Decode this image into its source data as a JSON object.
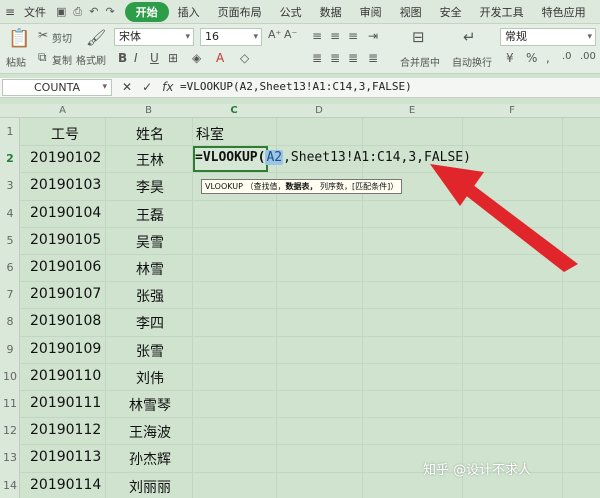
{
  "menubar": {
    "file_label": "文件",
    "tabs": [
      "开始",
      "插入",
      "页面布局",
      "公式",
      "数据",
      "审阅",
      "视图",
      "安全",
      "开发工具",
      "特色应用"
    ],
    "active_tab": "开始"
  },
  "ribbon": {
    "paste_label": "粘贴",
    "cut_label": "剪切",
    "copy_label": "复制",
    "format_painter_label": "格式刷",
    "font_name": "宋体",
    "font_size": "16",
    "merge_label": "合并居中",
    "wrap_label": "自动换行",
    "number_format": "常规"
  },
  "formula_bar": {
    "name_box": "COUNTA",
    "cancel_icon": "✕",
    "confirm_icon": "✓",
    "fx_label": "fx",
    "formula": "=VLOOKUP(A2,Sheet13!A1:C14,3,FALSE)"
  },
  "grid": {
    "columns": [
      "A",
      "B",
      "C",
      "D",
      "E",
      "F"
    ],
    "selected_column": "C",
    "rows": [
      "1",
      "2",
      "3",
      "4",
      "5",
      "6",
      "7",
      "8",
      "9",
      "10",
      "11",
      "12",
      "13",
      "14"
    ],
    "selected_row": "2",
    "header_a": "工号",
    "header_b": "姓名",
    "header_c": "科室",
    "ids": [
      "20190102",
      "20190103",
      "20190104",
      "20190105",
      "20190106",
      "20190107",
      "20190108",
      "20190109",
      "20190110",
      "20190111",
      "20190112",
      "20190113",
      "20190114"
    ],
    "names": [
      "王林",
      "李昊",
      "王磊",
      "吴雪",
      "林雪",
      "张强",
      "李四",
      "张雪",
      "刘伟",
      "林雪琴",
      "王海波",
      "孙杰辉",
      "刘丽丽"
    ]
  },
  "edit": {
    "prefix": "=VLOOKUP(",
    "ref": "A2",
    "rest": ",Sheet13!A1:C14,3,FALSE)",
    "tooltip_fn": "VLOOKUP",
    "tooltip_arg1": "（查找值，",
    "tooltip_arg2": "数据表，",
    "tooltip_arg3": "列序数，[匹配条件]）"
  },
  "watermark": "知乎 @设计不求人",
  "colors": {
    "accent": "#2e9d4a",
    "arrow": "#e0262b",
    "sheet_bg": "#cfe3cf"
  }
}
